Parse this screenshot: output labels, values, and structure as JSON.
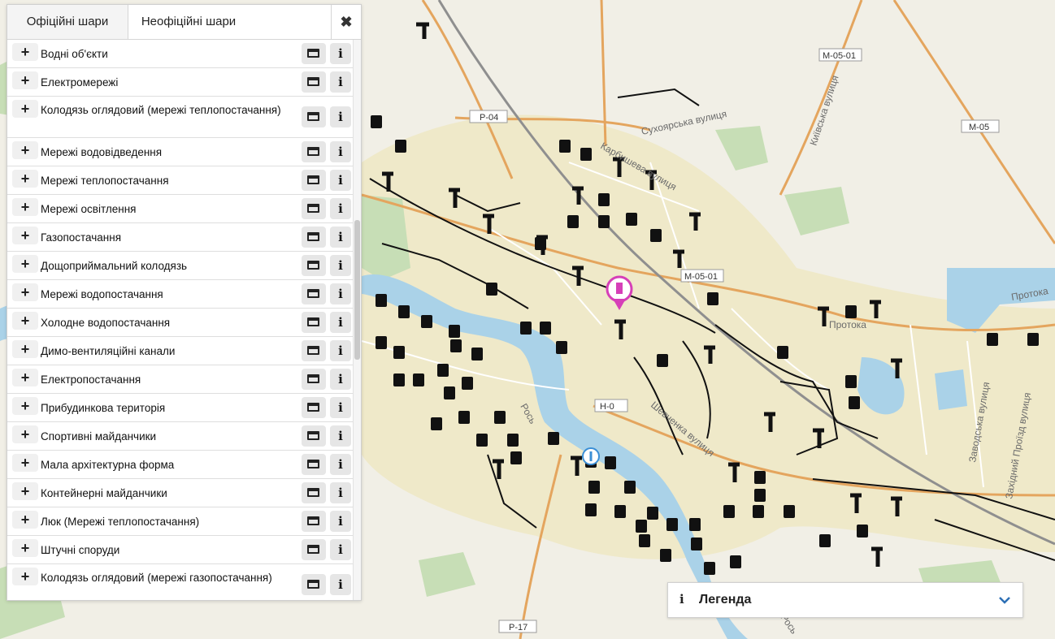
{
  "tabs": [
    {
      "label": "Офіційні шари",
      "active": true
    },
    {
      "label": "Неофіційні шари",
      "active": false
    }
  ],
  "close_label": "✖",
  "layers": [
    {
      "name": "Водні об'єкти"
    },
    {
      "name": "Електромережі"
    },
    {
      "name": "Колодязь оглядовий (мережі теплопостачання)"
    },
    {
      "name": "Мережі водовідведення"
    },
    {
      "name": "Мережі теплопостачання"
    },
    {
      "name": "Мережі освітлення"
    },
    {
      "name": "Газопостачання"
    },
    {
      "name": "Дощоприймальний колодязь"
    },
    {
      "name": "Мережі водопостачання"
    },
    {
      "name": "Холодне водопостачання"
    },
    {
      "name": "Димо-вентиляційні канали"
    },
    {
      "name": "Електропостачання"
    },
    {
      "name": "Прибудинкова територія"
    },
    {
      "name": "Спортивні майданчики"
    },
    {
      "name": "Мала архітектурна форма"
    },
    {
      "name": "Контейнерні майданчики"
    },
    {
      "name": "Люк (Мережі теплопостачання)"
    },
    {
      "name": "Штучні споруди"
    },
    {
      "name": "Колодязь оглядовий (мережі газопостачання)"
    }
  ],
  "layer_controls": {
    "plus": "+",
    "info": "i"
  },
  "legend": {
    "info": "i",
    "title": "Легенда"
  },
  "map": {
    "road_badges": [
      "Р-04",
      "М-05-01",
      "М-05",
      "М-05-01",
      "Н-0",
      "Р-17"
    ],
    "street_labels": [
      "Сухоярська вулиця",
      "Карбишева вулиця",
      "Київська вулиця",
      "Протока",
      "Протока",
      "Шевченка вулиця",
      "Заводська вулиця",
      "Західний Проїзд вулиця",
      "Рось",
      "Рось"
    ],
    "colors": {
      "land": "#f1efe6",
      "urban": "#efe9c9",
      "park": "#c7deb6",
      "water": "#aad2e8",
      "road_major": "#e4a55e",
      "road_minor": "#ffffff",
      "network_lines": "#111111",
      "poi_marker": "#d63fb8"
    }
  }
}
